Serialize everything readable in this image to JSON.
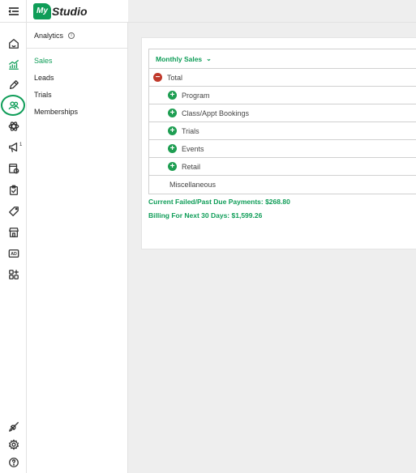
{
  "app": {
    "logo_mark": "My",
    "logo_text": "Studio"
  },
  "rail": {
    "announcement_badge": "1"
  },
  "submenu": {
    "title": "Analytics",
    "items": [
      {
        "label": "Sales",
        "active": true
      },
      {
        "label": "Leads",
        "active": false
      },
      {
        "label": "Trials",
        "active": false
      },
      {
        "label": "Memberships",
        "active": false
      }
    ]
  },
  "report": {
    "selector_label": "Monthly Sales",
    "total_label": "Total",
    "rows": [
      "Program",
      "Class/Appt Bookings",
      "Trials",
      "Events",
      "Retail"
    ],
    "misc_label": "Miscellaneous",
    "failed_payments": "Current Failed/Past Due Payments: $268.80",
    "billing_next_30": "Billing For Next 30 Days: $1,599.26"
  },
  "colors": {
    "brand": "#0f9d58",
    "collapse": "#c0392b"
  }
}
